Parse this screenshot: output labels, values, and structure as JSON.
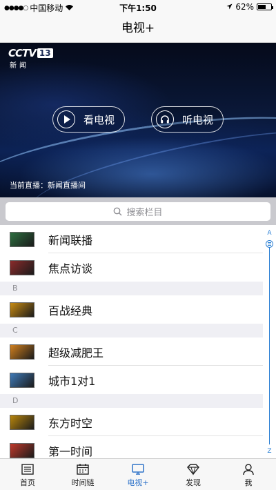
{
  "status_bar": {
    "signal": "●●●●○",
    "carrier": "中国移动",
    "time": "下午1:50",
    "battery_text": "62%",
    "battery_level": 0.62
  },
  "nav": {
    "title": "电视+"
  },
  "hero": {
    "logo_text": "CCTV",
    "logo_channel": "13",
    "logo_sub": "新闻",
    "watch_label": "看电视",
    "listen_label": "听电视",
    "live_text": "当前直播：新闻直播间"
  },
  "search": {
    "placeholder": "搜索栏目"
  },
  "list": {
    "items": [
      {
        "label": "新闻联播",
        "thumb_color": "#2c6e3f"
      },
      {
        "label": "焦点访谈",
        "thumb_color": "#8a2b2b"
      }
    ],
    "sections": [
      {
        "header": "B",
        "items": [
          {
            "label": "百战经典",
            "thumb_color": "#c78a12"
          }
        ]
      },
      {
        "header": "C",
        "items": [
          {
            "label": "超级减肥王",
            "thumb_color": "#d07f1e"
          },
          {
            "label": "城市1对1",
            "thumb_color": "#3f7ab8"
          }
        ]
      },
      {
        "header": "D",
        "items": [
          {
            "label": "东方时空",
            "thumb_color": "#b8860b"
          },
          {
            "label": "第一时间",
            "thumb_color": "#c0392b"
          }
        ]
      }
    ]
  },
  "index_bar": {
    "top": "A",
    "bottom": "Z"
  },
  "tabs": [
    {
      "label": "首页",
      "icon": "home-icon"
    },
    {
      "label": "时间链",
      "icon": "calendar-icon"
    },
    {
      "label": "电视+",
      "icon": "tv-icon",
      "active": true
    },
    {
      "label": "发现",
      "icon": "diamond-icon"
    },
    {
      "label": "我",
      "icon": "person-icon"
    }
  ],
  "colors": {
    "accent": "#2f73c9",
    "index": "#2a7fd4"
  }
}
